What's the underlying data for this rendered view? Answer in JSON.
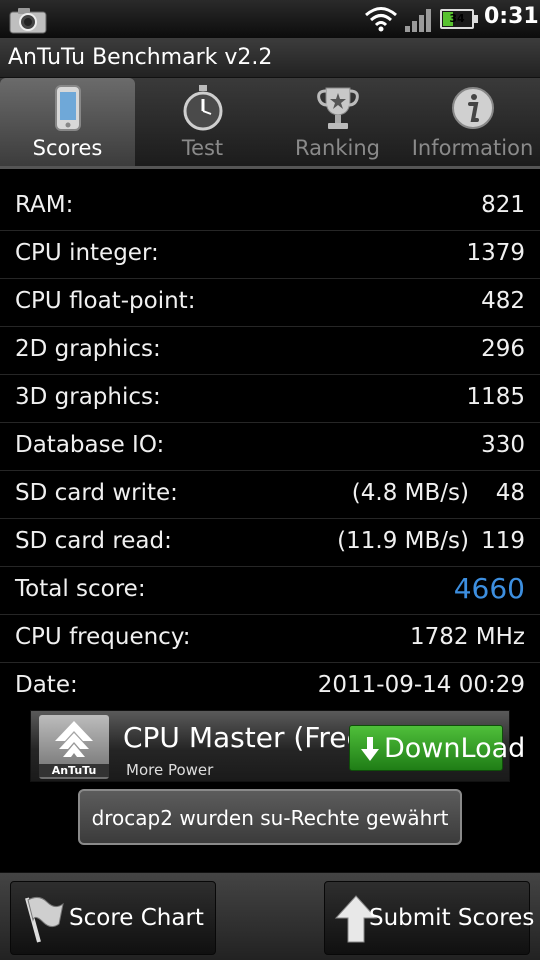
{
  "status_bar": {
    "battery_level": "34",
    "time": "0:31",
    "icons": [
      "camera-icon",
      "wifi-icon",
      "signal-icon",
      "battery-icon"
    ]
  },
  "app": {
    "title": "AnTuTu Benchmark v2.2"
  },
  "tabs": [
    {
      "label": "Scores",
      "icon": "phone-icon",
      "active": true
    },
    {
      "label": "Test",
      "icon": "stopwatch-icon",
      "active": false
    },
    {
      "label": "Ranking",
      "icon": "trophy-icon",
      "active": false
    },
    {
      "label": "Information",
      "icon": "info-icon",
      "active": false
    }
  ],
  "scores": {
    "ram": {
      "label": "RAM:",
      "value": "821"
    },
    "cpu_integer": {
      "label": "CPU integer:",
      "value": "1379"
    },
    "cpu_float": {
      "label": "CPU float-point:",
      "value": "482"
    },
    "graphics_2d": {
      "label": "2D graphics:",
      "value": "296"
    },
    "graphics_3d": {
      "label": "3D graphics:",
      "value": "1185"
    },
    "database_io": {
      "label": "Database IO:",
      "value": "330"
    },
    "sd_write": {
      "label": "SD card write:",
      "speed": "(4.8 MB/s)",
      "value": "48"
    },
    "sd_read": {
      "label": "SD card read:",
      "speed": "(11.9 MB/s)",
      "value": "119"
    },
    "total": {
      "label": "Total score:",
      "value": "4660",
      "color": "#3d8fe0"
    },
    "cpu_frequency": {
      "label": "CPU frequency:",
      "value": "1782 MHz"
    },
    "date": {
      "label": "Date:",
      "value": "2011-09-14 00:29"
    }
  },
  "ad": {
    "brand": "AnTuTu",
    "name": "CPU Master (Free)",
    "subtitle": "More Power",
    "download_label": "DownLoad"
  },
  "toast": {
    "message": "drocap2 wurden su-Rechte gewährt"
  },
  "buttons": {
    "score_chart": "Score Chart",
    "submit_scores": "Submit Scores"
  },
  "colors": {
    "accent_total": "#3d8fe0",
    "download_green": "#2e9a22",
    "battery_green": "#58c230"
  }
}
